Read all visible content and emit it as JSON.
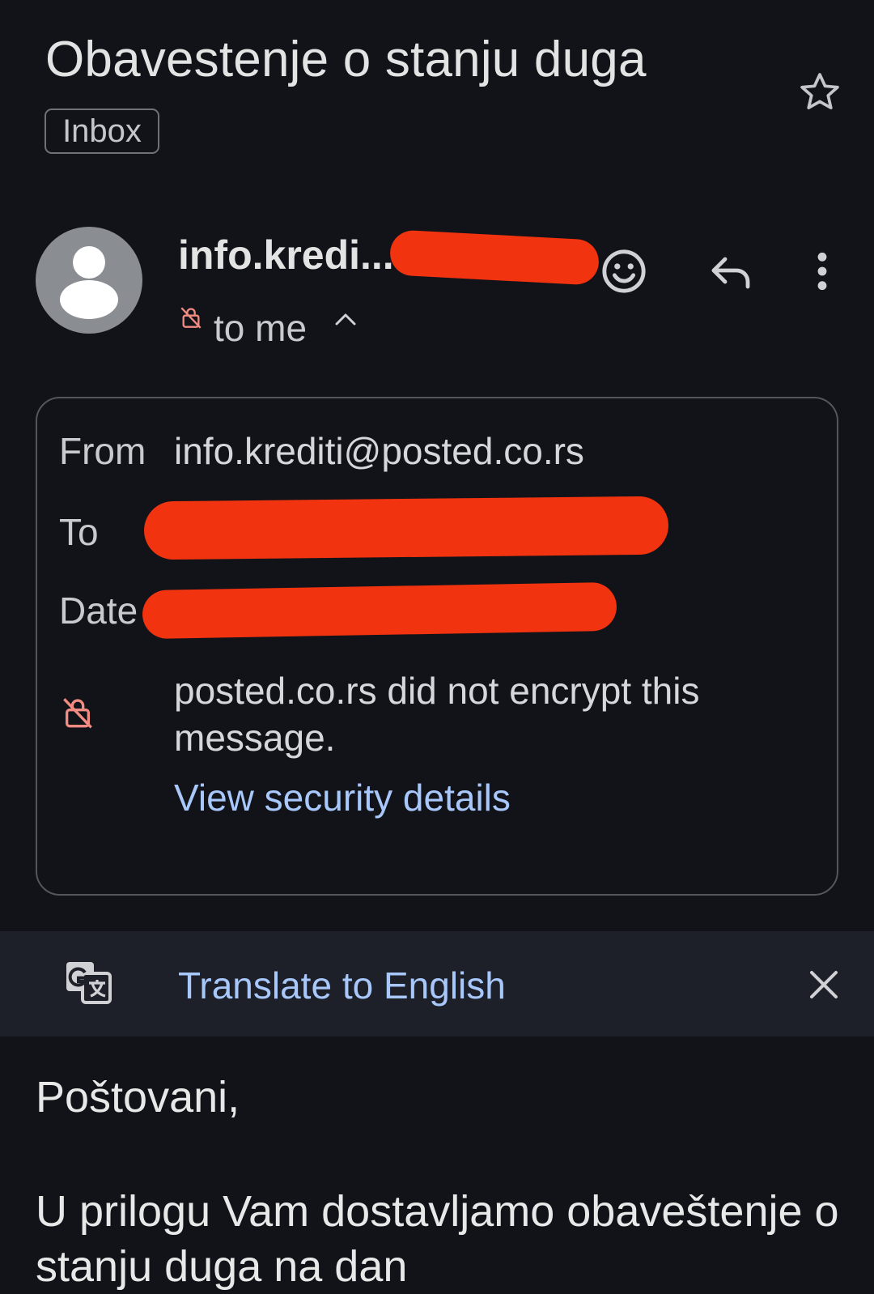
{
  "email": {
    "subject": "Obavestenje o stanju duga",
    "label": "Inbox",
    "sender_display": "info.kredi...",
    "recipient_summary": "to me",
    "details": {
      "from_label": "From",
      "from_value": "info.krediti@posted.co.rs",
      "to_label": "To",
      "date_label": "Date",
      "encryption_notice": "posted.co.rs did not encrypt this message.",
      "security_link": "View security details"
    },
    "translate": {
      "link": "Translate to English"
    },
    "body": {
      "greeting": "Poštovani,",
      "paragraph": "U prilogu Vam dostavljamo obaveštenje o stanju duga na dan"
    }
  },
  "icons": {
    "star": "star-outline-icon",
    "avatar": "person-icon",
    "emoji": "smiley-icon",
    "reply": "reply-icon",
    "more": "more-vert-icon",
    "lock": "lock-off-icon",
    "chevron": "chevron-up-icon",
    "translate": "translate-icon",
    "close": "close-icon"
  },
  "colors": {
    "background": "#121319",
    "link": "#a8c7fa",
    "warning": "#f28b82",
    "redaction": "#f2330f"
  }
}
